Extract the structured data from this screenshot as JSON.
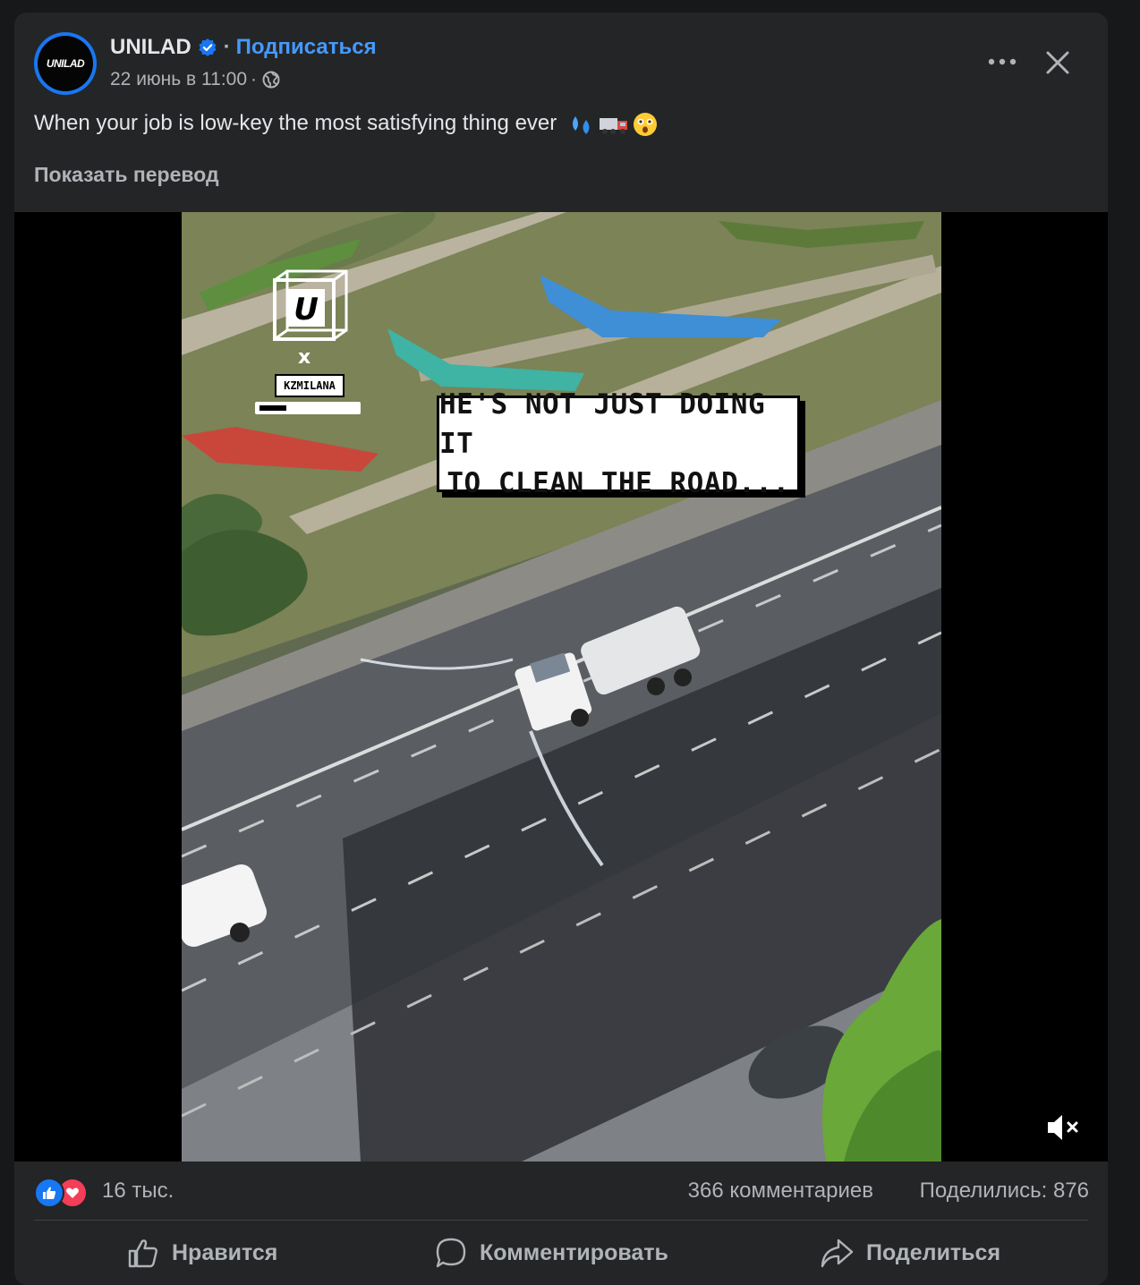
{
  "post": {
    "page_name": "UNILAD",
    "avatar_text": "UNILAD",
    "separator": "·",
    "subscribe_label": "Подписаться",
    "timestamp": "22 июнь в 11:00",
    "caption": "When your job is low-key the most satisfying thing ever",
    "caption_emojis": [
      "sweat-droplets",
      "truck",
      "astonished-face"
    ],
    "translate_label": "Показать перевод"
  },
  "video": {
    "overlay_text_line1": "HE'S NOT JUST DOING IT",
    "overlay_text_line2": "TO CLEAN THE ROAD...",
    "watermark_x": "x",
    "watermark_label": "KZMILANA",
    "progress": 0.28,
    "muted": true
  },
  "stats": {
    "reactions_count": "16 тыс.",
    "comments": "366 комментариев",
    "shares": "Поделились: 876"
  },
  "actions": {
    "like": "Нравится",
    "comment": "Комментировать",
    "share": "Поделиться"
  },
  "colors": {
    "accent": "#4599ff",
    "card_bg": "#242526",
    "like_blue": "#1877f2",
    "love_red": "#f33e58"
  }
}
